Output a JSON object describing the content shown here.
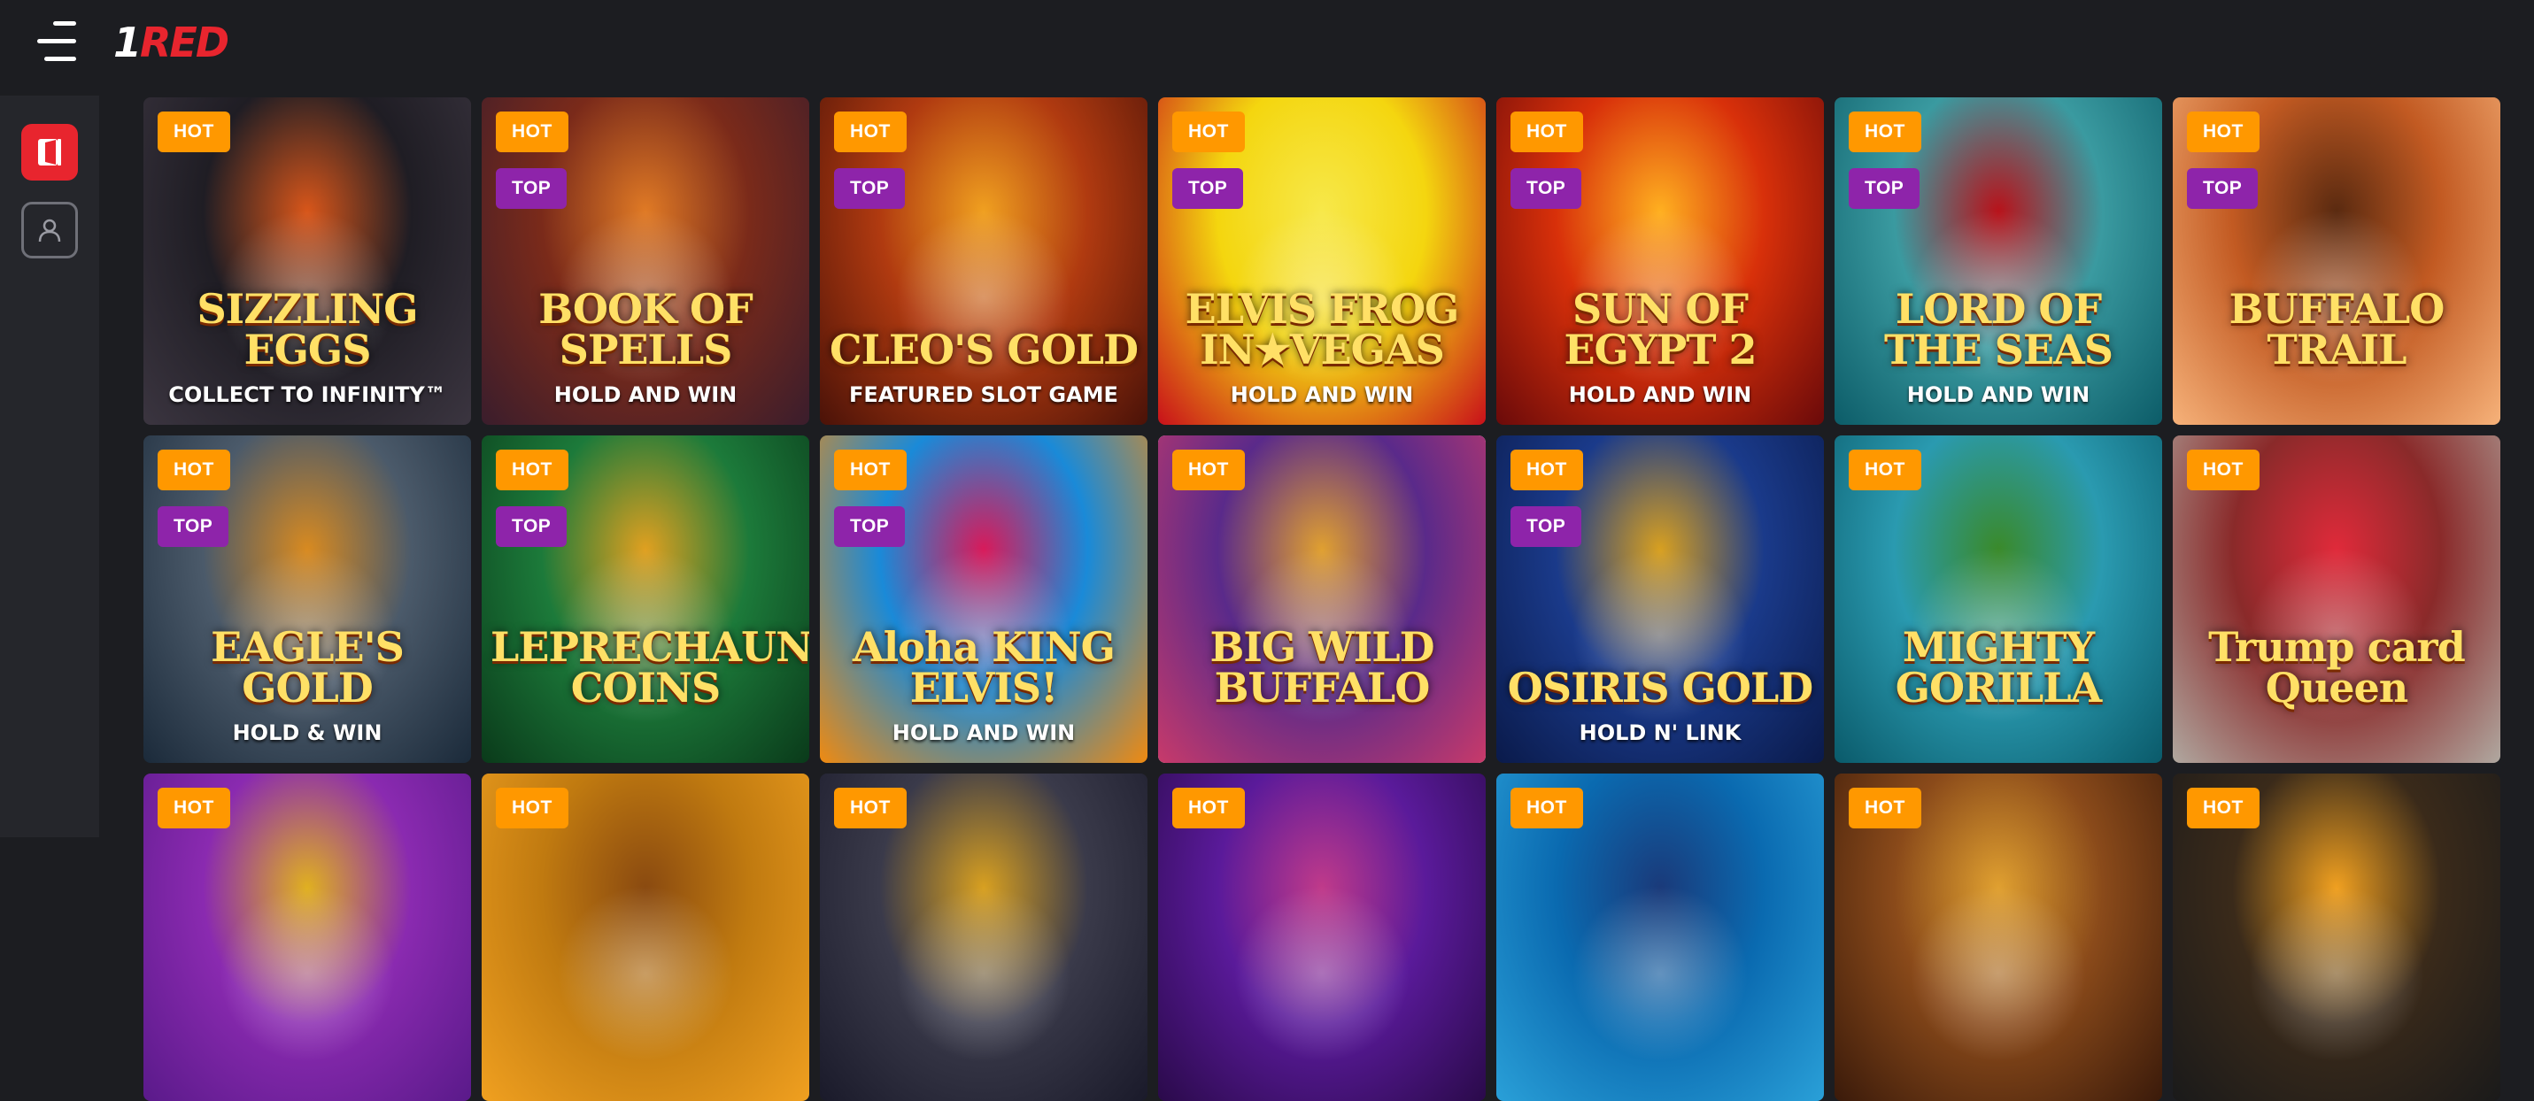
{
  "header": {
    "logo_one": "1",
    "logo_rest": "RED",
    "menu_icon": "hamburger-menu-icon"
  },
  "sidebar": {
    "items": [
      {
        "icon": "login-door-icon",
        "active": true
      },
      {
        "icon": "user-profile-icon",
        "active": false
      }
    ]
  },
  "badges": {
    "hot": "HOT",
    "top": "TOP"
  },
  "games": [
    {
      "title": "SIZZLING EGGS",
      "subtitle": "COLLECT TO INFINITY™",
      "hot": true,
      "top": false,
      "colors": [
        "#3b3540",
        "#1f1d24",
        "#d8561a"
      ]
    },
    {
      "title": "BOOK OF SPELLS",
      "subtitle": "HOLD AND WIN",
      "hot": true,
      "top": true,
      "colors": [
        "#3a1d2c",
        "#7a2a1a",
        "#e07a25"
      ]
    },
    {
      "title": "CLEO'S GOLD",
      "subtitle": "FEATURED SLOT GAME",
      "hot": true,
      "top": true,
      "colors": [
        "#4a1208",
        "#b03a10",
        "#f0a020"
      ]
    },
    {
      "title": "ELVIS FROG IN★VEGAS",
      "subtitle": "HOLD AND WIN",
      "hot": true,
      "top": true,
      "colors": [
        "#c8101a",
        "#f4d60f",
        "#f7e84a"
      ]
    },
    {
      "title": "SUN OF EGYPT 2",
      "subtitle": "HOLD AND WIN",
      "hot": true,
      "top": true,
      "colors": [
        "#6a0a0a",
        "#d8300a",
        "#ffb020"
      ]
    },
    {
      "title": "LORD OF THE SEAS",
      "subtitle": "HOLD AND WIN",
      "hot": true,
      "top": true,
      "colors": [
        "#0c5c68",
        "#3a9aa0",
        "#b8121a"
      ]
    },
    {
      "title": "BUFFALO TRAIL",
      "subtitle": "",
      "hot": true,
      "top": true,
      "colors": [
        "#f6b27a",
        "#c25a22",
        "#5a2a10"
      ]
    },
    {
      "title": "EAGLE'S GOLD",
      "subtitle": "HOLD & WIN",
      "hot": true,
      "top": true,
      "colors": [
        "#1b2a3a",
        "#4b5a6a",
        "#d88a20"
      ]
    },
    {
      "title": "LEPRECHAUN'S COINS",
      "subtitle": "",
      "hot": true,
      "top": true,
      "colors": [
        "#0a3a1a",
        "#1c7a3a",
        "#e0a020"
      ]
    },
    {
      "title": "Aloha KING ELVIS!",
      "subtitle": "HOLD AND WIN",
      "hot": true,
      "top": true,
      "colors": [
        "#f08a10",
        "#1a8ad8",
        "#d81a5a"
      ]
    },
    {
      "title": "BIG WILD BUFFALO",
      "subtitle": "",
      "hot": true,
      "top": false,
      "colors": [
        "#c83a6a",
        "#5a2a8a",
        "#e0a030"
      ]
    },
    {
      "title": "OSIRIS GOLD",
      "subtitle": "HOLD N' LINK",
      "hot": true,
      "top": true,
      "colors": [
        "#0a1a4a",
        "#1a3a8a",
        "#d8a020"
      ]
    },
    {
      "title": "MIGHTY GORILLA",
      "subtitle": "",
      "hot": true,
      "top": false,
      "colors": [
        "#0a5a6a",
        "#2a9ab0",
        "#3a8a2a"
      ]
    },
    {
      "title": "Trump card Queen",
      "subtitle": "",
      "hot": true,
      "top": false,
      "colors": [
        "#b0a8a0",
        "#8a2a2a",
        "#e02a3a"
      ]
    },
    {
      "title": "",
      "subtitle": "",
      "hot": true,
      "top": false,
      "colors": [
        "#5a1a8a",
        "#8a2ab0",
        "#e0b020"
      ]
    },
    {
      "title": "",
      "subtitle": "",
      "hot": true,
      "top": false,
      "colors": [
        "#f0a020",
        "#c07a10",
        "#8a4a10"
      ]
    },
    {
      "title": "",
      "subtitle": "",
      "hot": true,
      "top": false,
      "colors": [
        "#1a1a2a",
        "#3a3a4a",
        "#d8a020"
      ]
    },
    {
      "title": "",
      "subtitle": "",
      "hot": true,
      "top": false,
      "colors": [
        "#2a0a4a",
        "#5a1a9a",
        "#c03a8a"
      ]
    },
    {
      "title": "",
      "subtitle": "",
      "hot": true,
      "top": false,
      "colors": [
        "#2aa0d8",
        "#0a6ab0",
        "#1a3a7a"
      ]
    },
    {
      "title": "",
      "subtitle": "",
      "hot": true,
      "top": false,
      "colors": [
        "#3a1a0a",
        "#8a4a1a",
        "#e0a030"
      ]
    },
    {
      "title": "",
      "subtitle": "",
      "hot": true,
      "top": false,
      "colors": [
        "#1a1a1a",
        "#3a2a1a",
        "#f0a020"
      ]
    }
  ],
  "selected_game_index": 10
}
